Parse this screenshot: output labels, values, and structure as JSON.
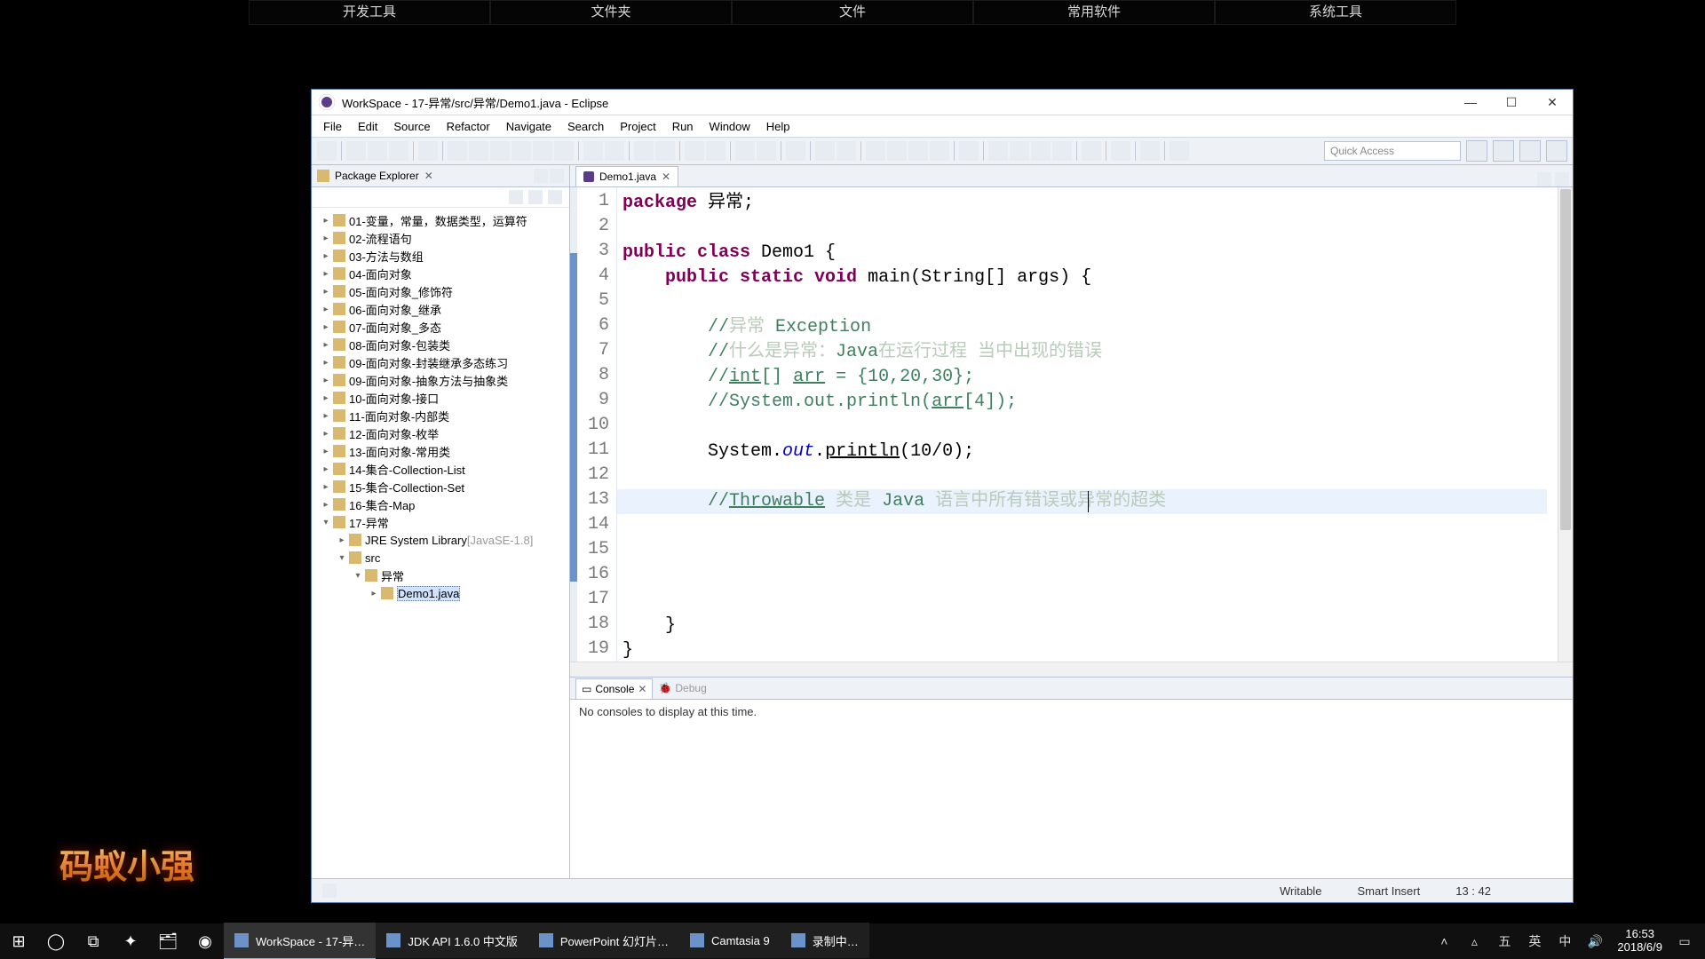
{
  "dock": [
    "开发工具",
    "文件夹",
    "文件",
    "常用软件",
    "系统工具"
  ],
  "logo_text": "码蚁小强",
  "window_title": "WorkSpace - 17-异常/src/异常/Demo1.java - Eclipse",
  "menus": [
    "File",
    "Edit",
    "Source",
    "Refactor",
    "Navigate",
    "Search",
    "Project",
    "Run",
    "Window",
    "Help"
  ],
  "quick_access": "Quick Access",
  "explorer_title": "Package Explorer",
  "tree": {
    "projects": [
      "01-变量，常量，数据类型，运算符",
      "02-流程语句",
      "03-方法与数组",
      "04-面向对象",
      "05-面向对象_修饰符",
      "06-面向对象_继承",
      "07-面向对象_多态",
      "08-面向对象-包装类",
      "09-面向对象-封装继承多态练习",
      "09-面向对象-抽象方法与抽象类",
      "10-面向对象-接口",
      "11-面向对象-内部类",
      "12-面向对象-枚举",
      "13-面向对象-常用类",
      "14-集合-Collection-List",
      "15-集合-Collection-Set",
      "16-集合-Map"
    ],
    "open_project": "17-异常",
    "jre_label": "JRE System Library",
    "jre_ver": "[JavaSE-1.8]",
    "src": "src",
    "pkg": "异常",
    "file": "Demo1.java"
  },
  "editor_tab": "Demo1.java",
  "code_lines": [
    {
      "n": 1,
      "segs": [
        {
          "t": "package ",
          "c": "kw"
        },
        {
          "t": "异常;"
        }
      ]
    },
    {
      "n": 2,
      "segs": []
    },
    {
      "n": 3,
      "segs": [
        {
          "t": "public class ",
          "c": "kw"
        },
        {
          "t": "Demo1 {"
        }
      ]
    },
    {
      "n": 4,
      "segs": [
        {
          "t": "    "
        },
        {
          "t": "public static void ",
          "c": "kw"
        },
        {
          "t": "main(String[] "
        },
        {
          "t": "args",
          "c": ""
        },
        {
          "t": ") {"
        }
      ]
    },
    {
      "n": 5,
      "segs": []
    },
    {
      "n": 6,
      "segs": [
        {
          "t": "        "
        },
        {
          "t": "//",
          "c": "cm"
        },
        {
          "t": "异常 ",
          "c": "cmcjk"
        },
        {
          "t": "Exception",
          "c": "cm"
        }
      ]
    },
    {
      "n": 7,
      "segs": [
        {
          "t": "        "
        },
        {
          "t": "//",
          "c": "cm"
        },
        {
          "t": "什么是异常：",
          "c": "cmcjk"
        },
        {
          "t": "Java",
          "c": "cm"
        },
        {
          "t": "在运行过程 当中出现的错误",
          "c": "cmcjk"
        }
      ]
    },
    {
      "n": 8,
      "segs": [
        {
          "t": "        "
        },
        {
          "t": "//",
          "c": "cm"
        },
        {
          "t": "int",
          "c": "cm udl"
        },
        {
          "t": "[] ",
          "c": "cm"
        },
        {
          "t": "arr",
          "c": "cm udl"
        },
        {
          "t": " = {10,20,30};",
          "c": "cm"
        }
      ]
    },
    {
      "n": 9,
      "segs": [
        {
          "t": "        "
        },
        {
          "t": "//System.out.println(",
          "c": "cm"
        },
        {
          "t": "arr",
          "c": "cm udl"
        },
        {
          "t": "[4]);",
          "c": "cm"
        }
      ]
    },
    {
      "n": 10,
      "segs": []
    },
    {
      "n": 11,
      "segs": [
        {
          "t": "        System."
        },
        {
          "t": "out",
          "c": "fld"
        },
        {
          "t": "."
        },
        {
          "t": "println",
          "c": "udl"
        },
        {
          "t": "(10/0);"
        }
      ]
    },
    {
      "n": 12,
      "segs": []
    },
    {
      "n": 13,
      "segs": [
        {
          "t": "        "
        },
        {
          "t": "//",
          "c": "cm"
        },
        {
          "t": "Throwable",
          "c": "cm udl"
        },
        {
          "t": " 类是 ",
          "c": "cmcjk"
        },
        {
          "t": "Java ",
          "c": "cm"
        },
        {
          "t": "语言中所有错误或异常的超类",
          "c": "cmcjk"
        }
      ],
      "hl": true,
      "caret": 530
    },
    {
      "n": 14,
      "segs": []
    },
    {
      "n": 15,
      "segs": []
    },
    {
      "n": 16,
      "segs": []
    },
    {
      "n": 17,
      "segs": []
    },
    {
      "n": 18,
      "segs": [
        {
          "t": "    }"
        }
      ]
    },
    {
      "n": 19,
      "segs": [
        {
          "t": "}"
        }
      ]
    }
  ],
  "console_tabs": {
    "active": "Console",
    "other": "Debug"
  },
  "console_msg": "No consoles to display at this time.",
  "status": {
    "writable": "Writable",
    "mode": "Smart Insert",
    "pos": "13 : 42"
  },
  "taskbar": {
    "apps": [
      {
        "label": "WorkSpace - 17-异…",
        "active": true
      },
      {
        "label": "JDK API 1.6.0 中文版"
      },
      {
        "label": "PowerPoint 幻灯片…"
      },
      {
        "label": "Camtasia 9"
      },
      {
        "label": "录制中…"
      }
    ],
    "ime1": "五",
    "ime2": "英",
    "ime3": "中",
    "time": "16:53",
    "date": "2018/6/9"
  }
}
